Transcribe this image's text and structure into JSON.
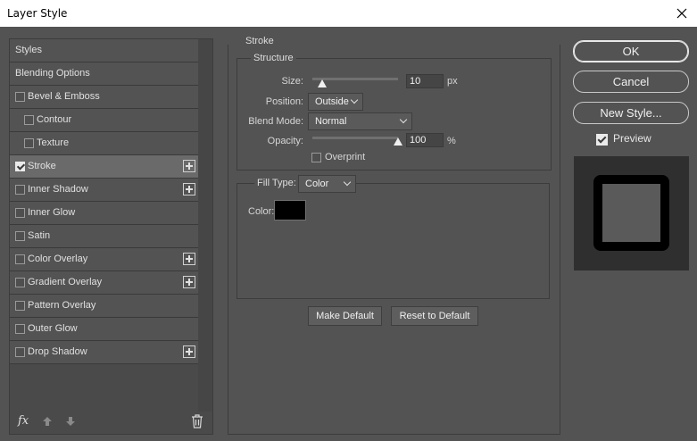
{
  "window": {
    "title": "Layer Style"
  },
  "sidebar": {
    "items": [
      {
        "label": "Styles",
        "checkbox": false,
        "checked": false,
        "plus": false,
        "indent": false,
        "active": false
      },
      {
        "label": "Blending Options",
        "checkbox": false,
        "checked": false,
        "plus": false,
        "indent": false,
        "active": false
      },
      {
        "label": "Bevel & Emboss",
        "checkbox": true,
        "checked": false,
        "plus": false,
        "indent": false,
        "active": false
      },
      {
        "label": "Contour",
        "checkbox": true,
        "checked": false,
        "plus": false,
        "indent": true,
        "active": false
      },
      {
        "label": "Texture",
        "checkbox": true,
        "checked": false,
        "plus": false,
        "indent": true,
        "active": false
      },
      {
        "label": "Stroke",
        "checkbox": true,
        "checked": true,
        "plus": true,
        "indent": false,
        "active": true
      },
      {
        "label": "Inner Shadow",
        "checkbox": true,
        "checked": false,
        "plus": true,
        "indent": false,
        "active": false
      },
      {
        "label": "Inner Glow",
        "checkbox": true,
        "checked": false,
        "plus": false,
        "indent": false,
        "active": false
      },
      {
        "label": "Satin",
        "checkbox": true,
        "checked": false,
        "plus": false,
        "indent": false,
        "active": false
      },
      {
        "label": "Color Overlay",
        "checkbox": true,
        "checked": false,
        "plus": true,
        "indent": false,
        "active": false
      },
      {
        "label": "Gradient Overlay",
        "checkbox": true,
        "checked": false,
        "plus": true,
        "indent": false,
        "active": false
      },
      {
        "label": "Pattern Overlay",
        "checkbox": true,
        "checked": false,
        "plus": false,
        "indent": false,
        "active": false
      },
      {
        "label": "Outer Glow",
        "checkbox": true,
        "checked": false,
        "plus": false,
        "indent": false,
        "active": false
      },
      {
        "label": "Drop Shadow",
        "checkbox": true,
        "checked": false,
        "plus": true,
        "indent": false,
        "active": false
      }
    ],
    "footer": {
      "fx_label": "fx"
    }
  },
  "stroke": {
    "group_title": "Stroke",
    "structure_title": "Structure",
    "size_label": "Size:",
    "size_value": "10",
    "size_unit": "px",
    "size_fraction": 0.02,
    "position_label": "Position:",
    "position_value": "Outside",
    "blend_mode_label": "Blend Mode:",
    "blend_mode_value": "Normal",
    "opacity_label": "Opacity:",
    "opacity_value": "100",
    "opacity_unit": "%",
    "opacity_fraction": 1.0,
    "overprint_label": "Overprint",
    "overprint_checked": false,
    "fill_type_label": "Fill Type:",
    "fill_type_value": "Color",
    "color_label": "Color:",
    "color_value": "#000000",
    "make_default_label": "Make Default",
    "reset_default_label": "Reset to Default"
  },
  "actions": {
    "ok_label": "OK",
    "cancel_label": "Cancel",
    "new_style_label": "New Style...",
    "preview_label": "Preview",
    "preview_checked": true
  },
  "colors": {
    "background": "#535353",
    "active_row": "#6a6a6a",
    "stroke_color": "#000000"
  }
}
